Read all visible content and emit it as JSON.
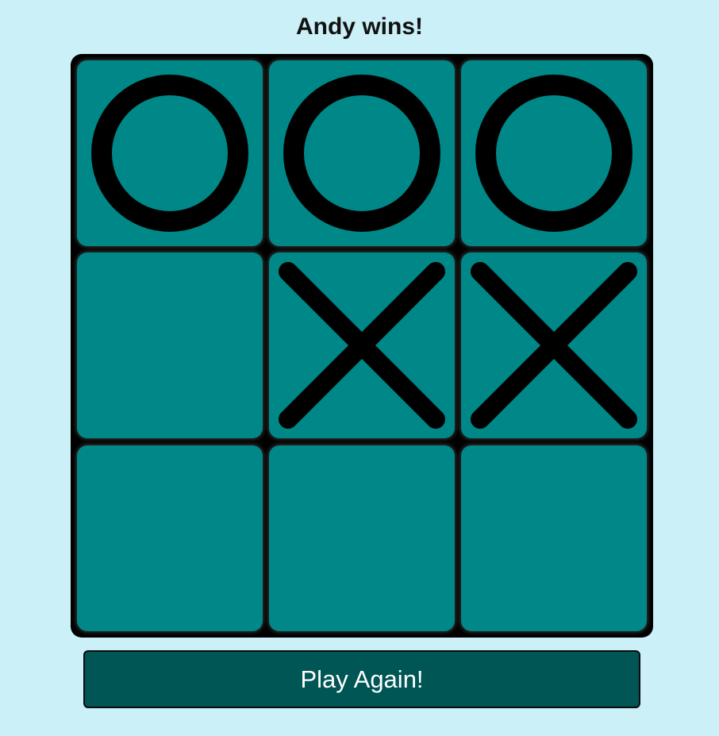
{
  "status": {
    "text": "Andy wins!"
  },
  "board": {
    "cells": [
      "O",
      "O",
      "O",
      "",
      "X",
      "X",
      "",
      "",
      ""
    ]
  },
  "play_again": {
    "label": "Play Again!"
  },
  "colors": {
    "page_background": "#cbf0f8",
    "board_border": "#000000",
    "cell": "#008787",
    "mark": "#000000",
    "button": "#005555",
    "button_text": "#ffffff"
  }
}
